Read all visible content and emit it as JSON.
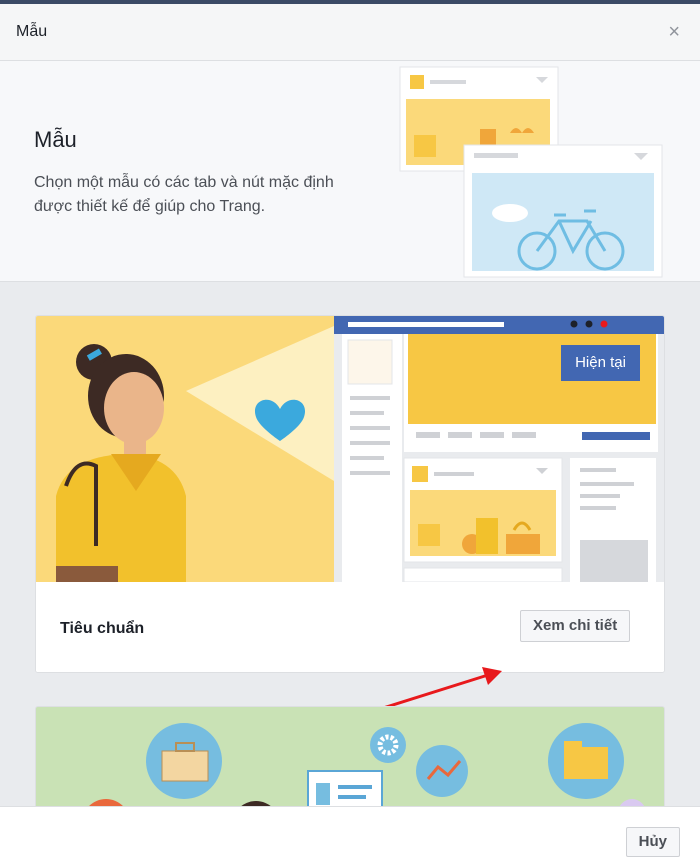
{
  "dialog": {
    "title": "Mẫu",
    "close_symbol": "×"
  },
  "intro": {
    "title": "Mẫu",
    "description": "Chọn một mẫu có các tab và nút mặc định được thiết kế để giúp cho Trang."
  },
  "templates": [
    {
      "name": "Tiêu chuẩn",
      "badge": "Hiện tại",
      "details_label": "Xem chi tiết"
    }
  ],
  "footer": {
    "cancel_label": "Hủy"
  },
  "icons": [
    "close-icon",
    "heart-icon",
    "bicycle-icon",
    "briefcase-icon",
    "gear-icon",
    "chart-icon",
    "folder-icon",
    "id-card-icon"
  ],
  "colors": {
    "accent": "#4267b2",
    "yellow": "#f7c744",
    "annotation_arrow": "#e8191c"
  }
}
